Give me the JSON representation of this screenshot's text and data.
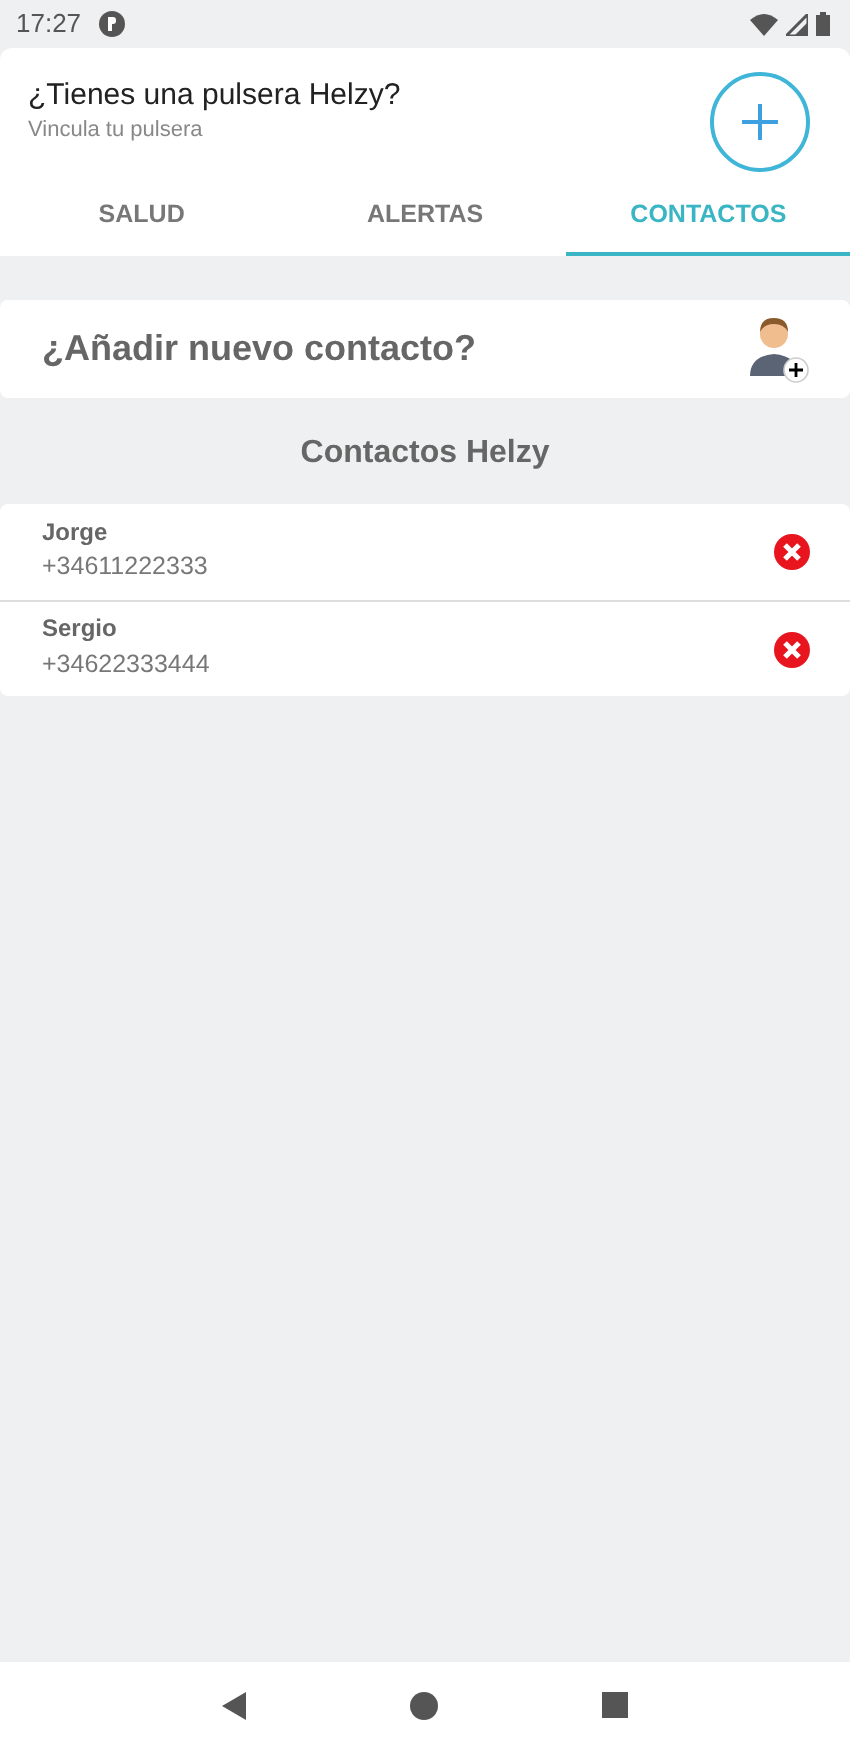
{
  "status_bar": {
    "time": "17:27"
  },
  "header": {
    "title": "¿Tienes una pulsera Helzy?",
    "subtitle": "Vincula tu pulsera"
  },
  "tabs": [
    {
      "label": "SALUD",
      "selected": false
    },
    {
      "label": "ALERTAS",
      "selected": false
    },
    {
      "label": "CONTACTOS",
      "selected": true
    }
  ],
  "add_contact": {
    "label": "¿Añadir nuevo contacto?"
  },
  "section_title": "Contactos Helzy",
  "contacts": [
    {
      "name": "Jorge",
      "phone": "+34611222333"
    },
    {
      "name": "Sergio",
      "phone": "+34622333444"
    }
  ]
}
